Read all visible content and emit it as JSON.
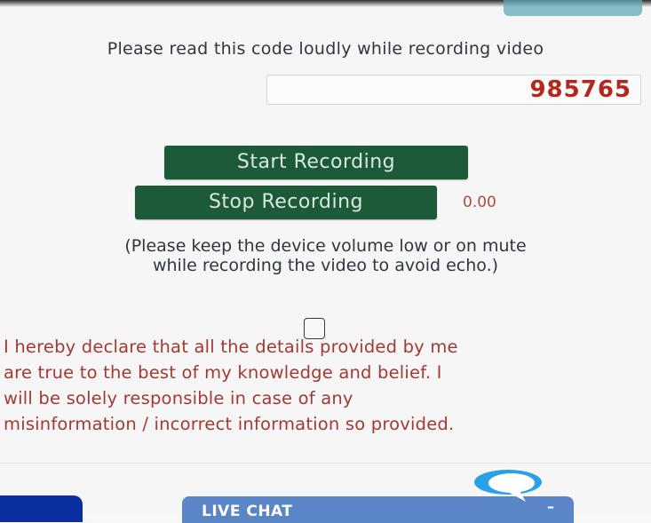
{
  "instruction": "Please read this code loudly while recording video",
  "code": "985765",
  "buttons": {
    "start": "Start Recording",
    "stop": "Stop Recording"
  },
  "timer": "0.00",
  "note_line1": "(Please keep the device volume low or on mute",
  "note_line2": "while recording the video to avoid echo.)",
  "declaration": [
    "I hereby declare that all the details provided by me",
    "are true to the best of my knowledge and belief. I",
    "will be solely responsible in case of any",
    "misinformation / incorrect information so provided."
  ],
  "chat": {
    "label": "LIVE CHAT",
    "minimize": "–"
  },
  "colors": {
    "button_green": "#1c5a3a",
    "code_red": "#b3271c",
    "declaration_red": "#a33a32",
    "chat_blue": "#5a86c8"
  },
  "icons": [
    "chat-bubble-icon"
  ]
}
